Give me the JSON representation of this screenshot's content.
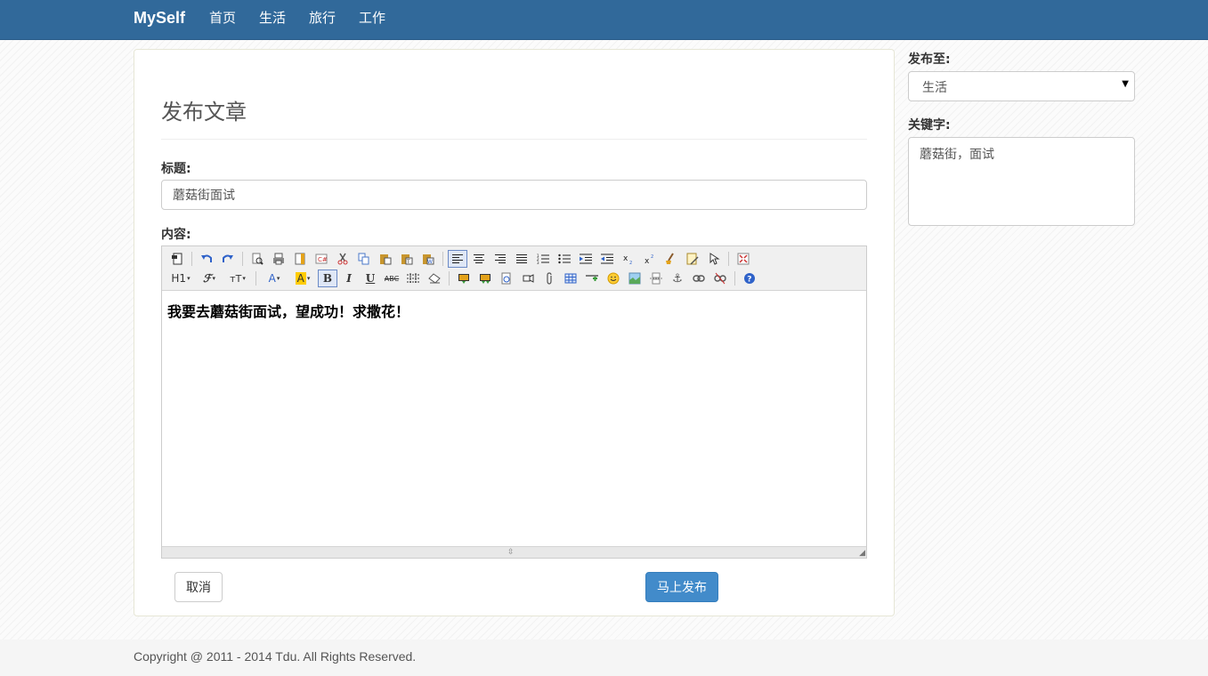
{
  "nav": {
    "brand": "MySelf",
    "items": [
      {
        "label": "首页"
      },
      {
        "label": "生活"
      },
      {
        "label": "旅行"
      },
      {
        "label": "工作"
      }
    ]
  },
  "form": {
    "page_title": "发布文章",
    "title_label": "标题:",
    "title_value": "蘑菇街面试",
    "content_label": "内容:",
    "content_text": "我要去蘑菇街面试，望成功！求撒花！",
    "cancel_label": "取消",
    "publish_label": "马上发布"
  },
  "editor_toolbar": {
    "row1_icons": [
      "source-icon",
      "undo-icon",
      "redo-icon",
      "preview-icon",
      "print-icon",
      "template-icon",
      "code-icon",
      "cut-icon",
      "copy-icon",
      "paste-icon",
      "paste-plain-icon",
      "paste-word-icon",
      "align-left-icon",
      "align-center-icon",
      "align-right-icon",
      "align-justify-icon",
      "ordered-list-icon",
      "unordered-list-icon",
      "indent-icon",
      "outdent-icon",
      "subscript-icon",
      "superscript-icon",
      "clear-format-icon",
      "select-all-icon",
      "quick-format-icon",
      "fullscreen-icon"
    ],
    "row2_icons": [
      "heading-icon",
      "font-family-icon",
      "font-size-icon",
      "font-color-icon",
      "highlight-color-icon",
      "bold-icon",
      "italic-icon",
      "underline-icon",
      "strikethrough-icon",
      "line-height-icon",
      "remove-format-icon",
      "image-icon",
      "multi-image-icon",
      "flash-icon",
      "media-icon",
      "attachment-icon",
      "table-icon",
      "horizontal-rule-icon",
      "emoticon-icon",
      "map-icon",
      "page-break-icon",
      "anchor-icon",
      "link-icon",
      "unlink-icon",
      "help-icon"
    ],
    "heading_label": "H1",
    "font_size_label": "тT",
    "font_color_label": "A",
    "highlight_label": "A",
    "bold_label": "B",
    "italic_label": "I",
    "underline_label": "U",
    "strike_label": "ABC"
  },
  "sidebar": {
    "publish_to_label": "发布至:",
    "publish_to_value": "生活",
    "keywords_label": "关键字:",
    "keywords_value": "蘑菇街，面试"
  },
  "footer": {
    "copyright": "Copyright @ 2011 - 2014 Tdu. All Rights Reserved."
  },
  "colors": {
    "navbar": "#31699a",
    "primary_button": "#428bca",
    "active_tool_border": "#6b8ac6"
  }
}
